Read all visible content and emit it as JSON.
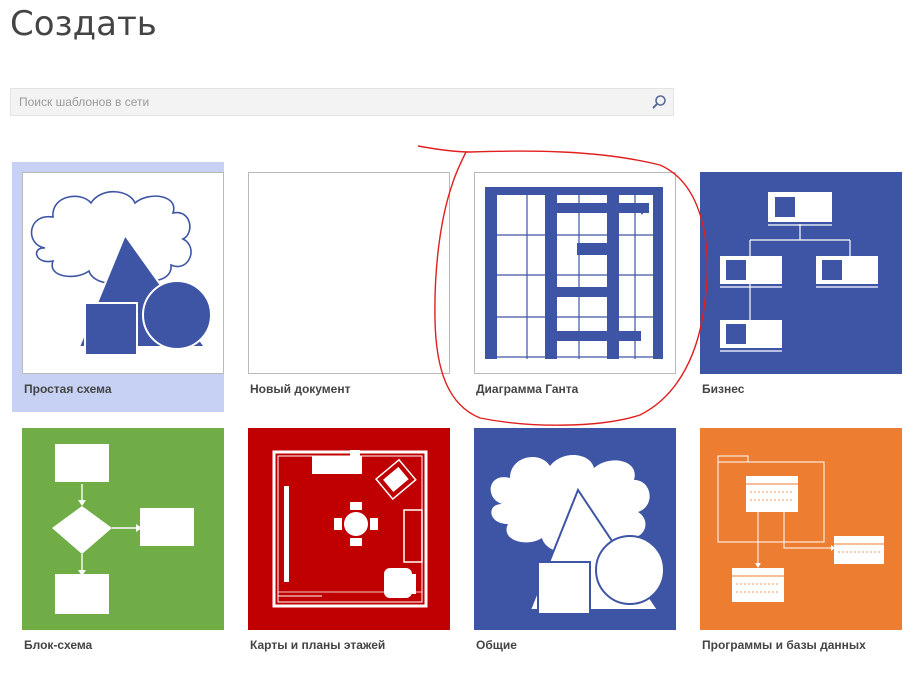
{
  "header": {
    "title": "Создать"
  },
  "search": {
    "placeholder": "Поиск шаблонов в сети",
    "icon": "search-icon"
  },
  "templates": [
    {
      "label": "Простая схема",
      "selected": true,
      "color": "#3e55a5"
    },
    {
      "label": "Новый документ",
      "selected": false,
      "color": "#ffffff"
    },
    {
      "label": "Диаграмма Ганта",
      "selected": false,
      "color": "#3e55a5"
    },
    {
      "label": "Бизнес",
      "selected": false,
      "color": "#3e55a5"
    },
    {
      "label": "Блок-схема",
      "selected": false,
      "color": "#70ad47"
    },
    {
      "label": "Карты и планы этажей",
      "selected": false,
      "color": "#c00000"
    },
    {
      "label": "Общие",
      "selected": false,
      "color": "#3e55a5"
    },
    {
      "label": "Программы и базы данных",
      "selected": false,
      "color": "#ed7d31"
    }
  ],
  "annotation": {
    "color": "#e02020"
  }
}
